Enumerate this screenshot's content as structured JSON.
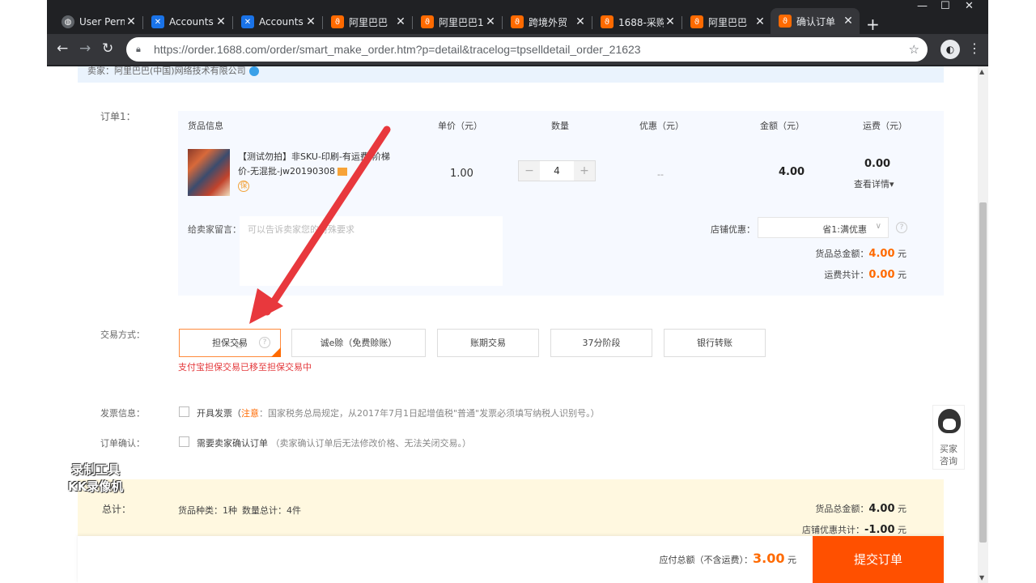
{
  "browser": {
    "tabs": [
      {
        "label": "User Perm",
        "color": "#5f6368",
        "icon": "globe-icon"
      },
      {
        "label": "Accounts",
        "color": "#1a73e8",
        "icon": "accounts-icon"
      },
      {
        "label": "Accounts",
        "color": "#1a73e8",
        "icon": "accounts-icon"
      },
      {
        "label": "阿里巴巴",
        "color": "#ff6a00",
        "icon": "alibaba-icon"
      },
      {
        "label": "阿里巴巴1",
        "color": "#ff6a00",
        "icon": "alibaba-icon"
      },
      {
        "label": "跨境外贸",
        "color": "#ff6a00",
        "icon": "alibaba-icon"
      },
      {
        "label": "1688-采购",
        "color": "#ff6a00",
        "icon": "alibaba-icon"
      },
      {
        "label": "阿里巴巴",
        "color": "#ff6a00",
        "icon": "alibaba-icon"
      },
      {
        "label": "确认订单",
        "color": "#ff6a00",
        "icon": "alibaba-icon"
      }
    ],
    "url": "https://order.1688.com/order/smart_make_order.htm?p=detail&tracelog=tpselldetail_order_21623"
  },
  "seller": {
    "label": "卖家：阿里巴巴(中国)网络技术有限公司"
  },
  "order": {
    "label": "订单1：",
    "headers": {
      "info": "货品信息",
      "price": "单价（元）",
      "qty": "数量",
      "discount": "优惠（元）",
      "amount": "金额（元）",
      "shipping": "运费（元）"
    },
    "product": {
      "title_line1": "【测试勿拍】非SKU-印刷-有运费-阶梯",
      "title_line2": "价-无混批-jw20190308",
      "price": "1.00",
      "qty": "4",
      "discount": "--",
      "amount": "4.00",
      "shipping": "0.00",
      "detail": "查看详情▾"
    },
    "message_label": "给卖家留言：",
    "message_placeholder": "可以告诉卖家您的特殊要求",
    "coupon_label": "店铺优惠：",
    "coupon_value": "省1:满优惠",
    "goods_total_label": "货品总金额：",
    "goods_total": "4.00",
    "ship_total_label": "运费共计：",
    "ship_total": "0.00",
    "yuan": "元"
  },
  "payment": {
    "label": "交易方式：",
    "options": [
      "担保交易",
      "诚e赊（免费赊账）",
      "账期交易",
      "37分阶段",
      "银行转账"
    ],
    "note": "支付宝担保交易已移至担保交易中"
  },
  "invoice": {
    "label": "发票信息：",
    "option": "开具发票（",
    "note_word": "注意",
    "note_rest": "：国家税务总局规定，从2017年7月1日起增值税\"普通\"发票必须填写纳税人识别号。）"
  },
  "confirm": {
    "label": "订单确认：",
    "option": "需要卖家确认订单",
    "hint": "（卖家确认订单后无法修改价格、无法关闭交易。）"
  },
  "summary": {
    "label": "总计：",
    "kinds": "货品种类：1种",
    "count": "数量总计：4件",
    "goods_total_label": "货品总金额：",
    "goods_total": "4.00",
    "shop_discount_label": "店铺优惠共计：",
    "shop_discount": "-1.00",
    "yuan": "元"
  },
  "submit": {
    "payable_label": "应付总额（不含运费）：",
    "payable": "3.00",
    "yuan": "元",
    "button": "提交订单"
  },
  "customer_service": {
    "line1": "买家",
    "line2": "咨询"
  },
  "watermark": {
    "line1": "录制工具",
    "line2": "KK录像机"
  },
  "colors": {
    "accent": "#ff6a00",
    "submit": "#ff5000",
    "arrow": "#e8383d"
  }
}
